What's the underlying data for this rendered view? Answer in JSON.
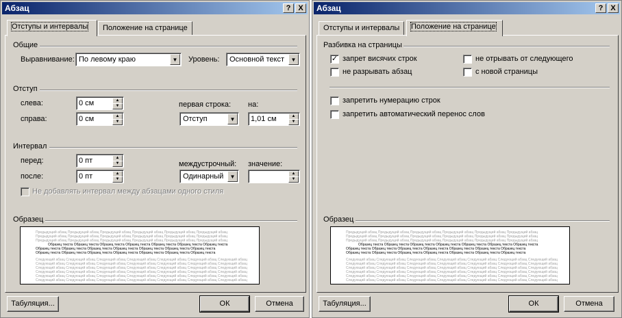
{
  "dialog1": {
    "title": "Абзац",
    "help_label": "?",
    "close_label": "X",
    "tabs": [
      {
        "label": "Отступы и интервалы"
      },
      {
        "label": "Положение на странице"
      }
    ],
    "general": {
      "section": "Общие",
      "align_label": "Выравнивание:",
      "align_value": "По левому краю",
      "level_label": "Уровень:",
      "level_value": "Основной текст"
    },
    "indent": {
      "section": "Отступ",
      "left_label": "слева:",
      "left_value": "0 см",
      "right_label": "справа:",
      "right_value": "0 см",
      "first_line_label": "первая строка:",
      "first_line_value": "Отступ",
      "by_label": "на:",
      "by_value": "1,01 см"
    },
    "spacing": {
      "section": "Интервал",
      "before_label": "перед:",
      "before_value": "0 пт",
      "after_label": "после:",
      "after_value": "0 пт",
      "line_label": "междустрочный:",
      "line_value": "Одинарный",
      "at_label": "значение:",
      "at_value": "",
      "no_space_label": "Не добавлять интервал между абзацами одного стиля"
    },
    "preview_label": "Образец",
    "tabs_button": "Табуляция...",
    "ok_button": "ОК",
    "cancel_button": "Отмена"
  },
  "dialog2": {
    "title": "Абзац",
    "help_label": "?",
    "close_label": "X",
    "tabs": [
      {
        "label": "Отступы и интервалы"
      },
      {
        "label": "Положение на странице"
      }
    ],
    "pagination": {
      "section": "Разбивка на страницы",
      "widow_label": "запрет висячих строк",
      "widow_checked": true,
      "keep_next_label": "не отрывать от следующего",
      "keep_next_checked": false,
      "keep_lines_label": "не разрывать абзац",
      "keep_lines_checked": false,
      "page_break_label": "с новой страницы",
      "page_break_checked": false
    },
    "suppress_lines_label": "запретить нумерацию строк",
    "no_hyphen_label": "запретить автоматический перенос слов",
    "preview_label": "Образец",
    "tabs_button": "Табуляция...",
    "ok_button": "ОК",
    "cancel_button": "Отмена"
  },
  "preview_text": {
    "prev": "Предыдущий абзац Предыдущий абзац Предыдущий абзац Предыдущий абзац Предыдущий абзац Предыдущий абзац",
    "cur": "Образец текста Образец текста Образец текста Образец текста Образец текста Образец текста Образец текста",
    "next": "Следующий абзац Следующий абзац Следующий абзац Следующий абзац Следующий абзац Следующий абзац Следующий абзац"
  }
}
